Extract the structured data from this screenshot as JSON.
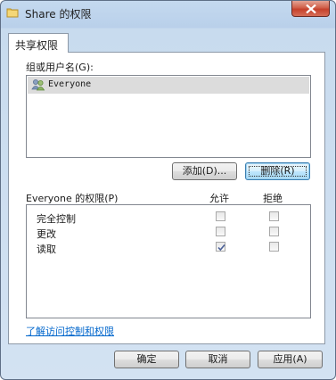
{
  "window": {
    "title": "Share 的权限",
    "title_icon": "folder-icon",
    "close_icon": "close-icon"
  },
  "tab": {
    "label": "共享权限"
  },
  "groups": {
    "label": "组或用户名(G):",
    "items": [
      {
        "name": "Everyone",
        "icon": "users-icon"
      }
    ]
  },
  "buttons": {
    "add": "添加(D)...",
    "remove": "删除(R)"
  },
  "permissions": {
    "header": "Everyone 的权限(P)",
    "allow_header": "允许",
    "deny_header": "拒绝",
    "rows": [
      {
        "name": "完全控制",
        "allow": false,
        "deny": false
      },
      {
        "name": "更改",
        "allow": false,
        "deny": false
      },
      {
        "name": "读取",
        "allow": true,
        "deny": false
      }
    ]
  },
  "link": {
    "text": "了解访问控制和权限"
  },
  "footer": {
    "ok": "确定",
    "cancel": "取消",
    "apply": "应用(A)"
  }
}
